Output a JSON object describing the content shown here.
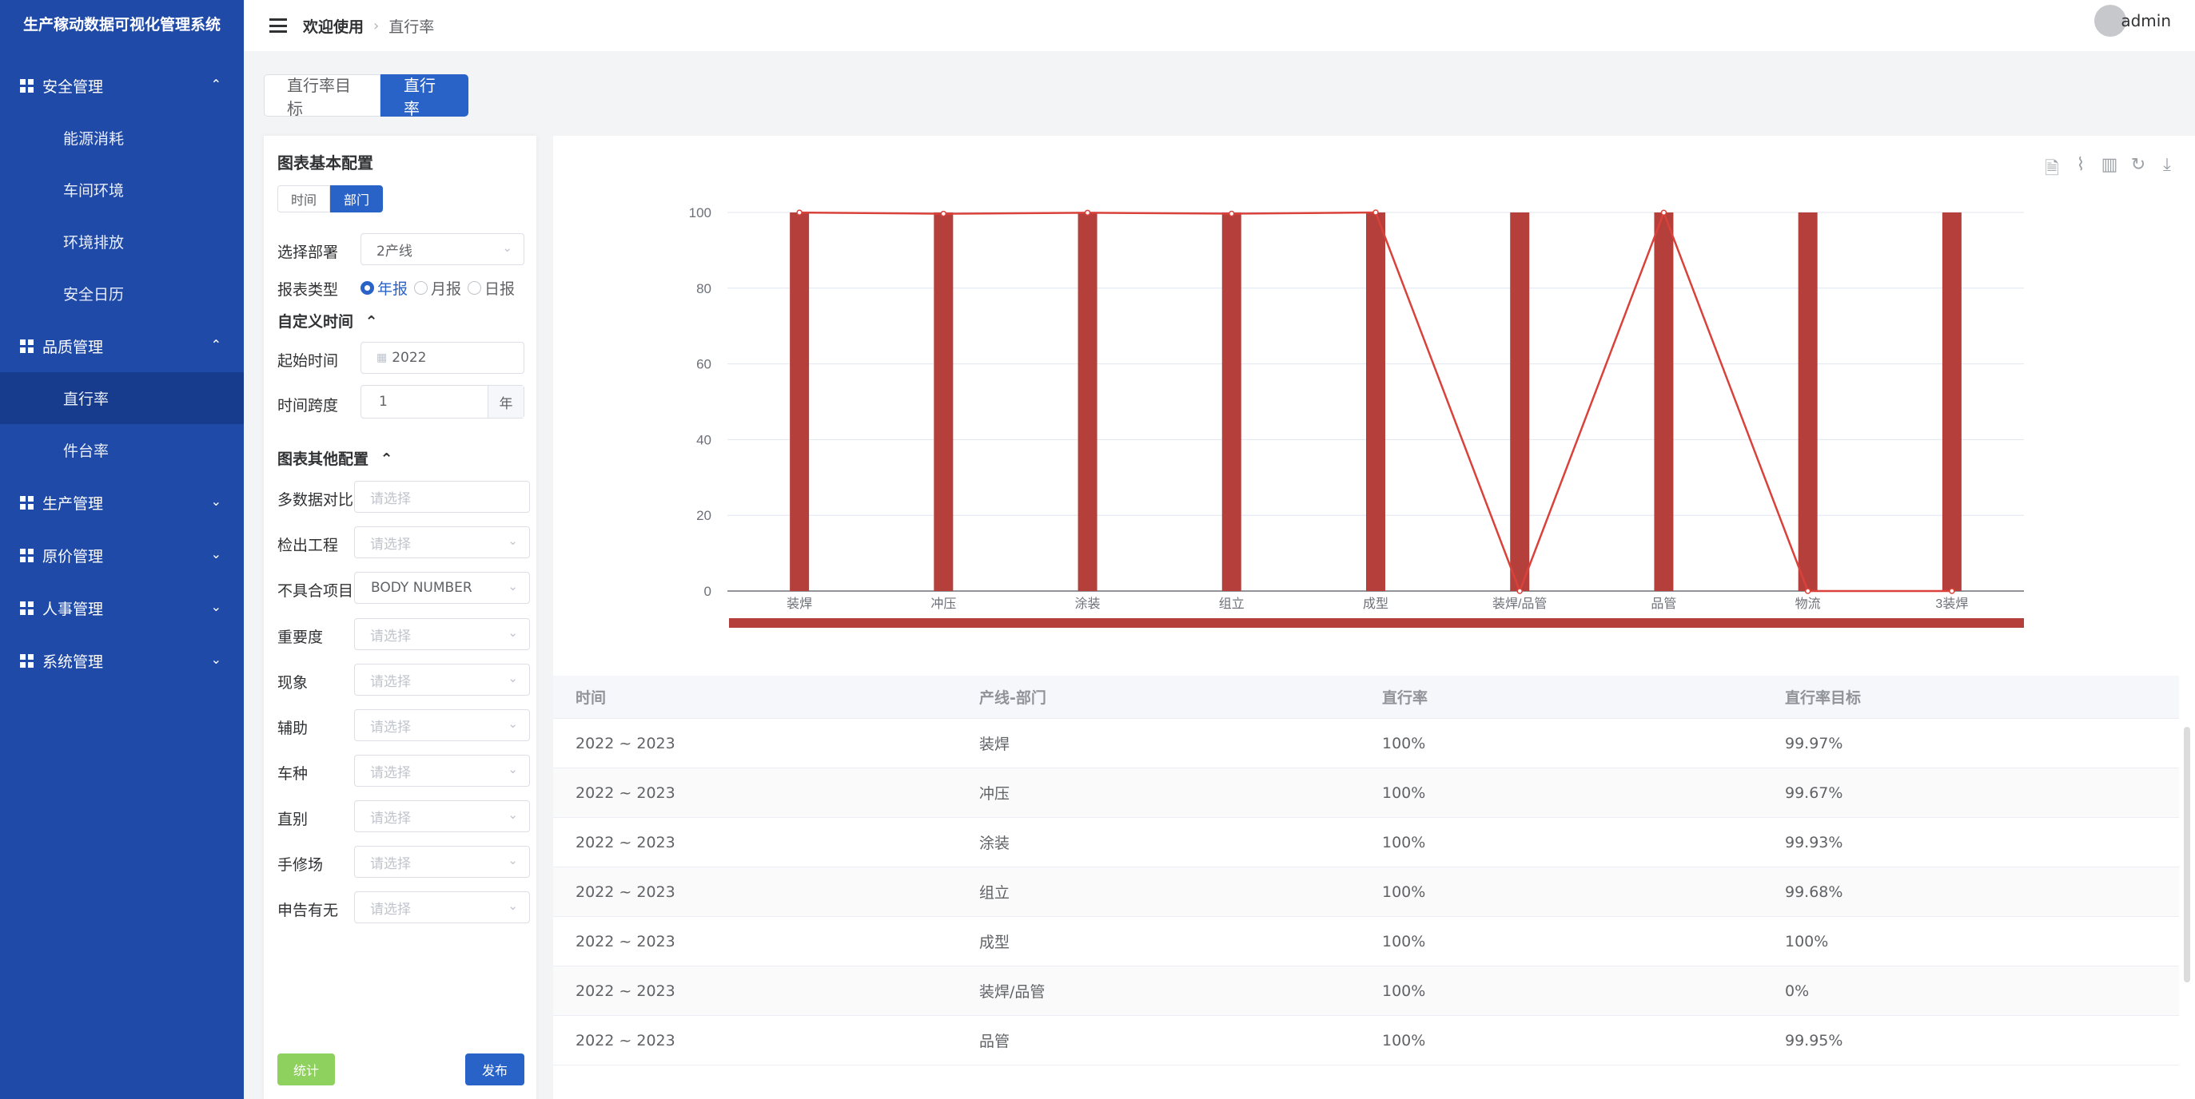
{
  "app": {
    "title": "生产稼动数据可视化管理系统"
  },
  "sidebar": {
    "groups": [
      {
        "label": "安全管理",
        "expanded": true,
        "items": [
          "能源消耗",
          "车间环境",
          "环境排放",
          "安全日历"
        ]
      },
      {
        "label": "品质管理",
        "expanded": true,
        "items": [
          "直行率",
          "件台率"
        ]
      },
      {
        "label": "生产管理",
        "expanded": false
      },
      {
        "label": "原价管理",
        "expanded": false
      },
      {
        "label": "人事管理",
        "expanded": false
      },
      {
        "label": "系统管理",
        "expanded": false
      }
    ],
    "active_item": "直行率"
  },
  "header": {
    "breadcrumb": [
      "欢迎使用",
      "直行率"
    ],
    "user": "admin"
  },
  "tabs": [
    {
      "label": "直行率目标",
      "active": false
    },
    {
      "label": "直行率",
      "active": true
    }
  ],
  "config": {
    "basic_title": "图表基本配置",
    "mode_options": [
      "时间",
      "部门"
    ],
    "mode_selected": "部门",
    "dept_label": "选择部署",
    "dept_value": "2产线",
    "report_type_label": "报表类型",
    "report_types": [
      "年报",
      "月报",
      "日报"
    ],
    "report_type_selected": "年报",
    "custom_time_title": "自定义时间",
    "start_label": "起始时间",
    "start_value": "2022",
    "span_label": "时间跨度",
    "span_value": "1",
    "span_unit": "年",
    "other_title": "图表其他配置",
    "placeholder": "请选择",
    "fields": [
      {
        "label": "多数据对比",
        "value": ""
      },
      {
        "label": "检出工程",
        "value": ""
      },
      {
        "label": "不具合项目",
        "value": "BODY NUMBER"
      },
      {
        "label": "重要度",
        "value": ""
      },
      {
        "label": "现象",
        "value": ""
      },
      {
        "label": "辅助",
        "value": ""
      },
      {
        "label": "车种",
        "value": ""
      },
      {
        "label": "直别",
        "value": ""
      },
      {
        "label": "手修场",
        "value": ""
      },
      {
        "label": "申告有无",
        "value": ""
      }
    ],
    "btn_stat": "统计",
    "btn_publish": "发布"
  },
  "chart_data": {
    "type": "bar",
    "categories": [
      "装焊",
      "冲压",
      "涂装",
      "组立",
      "成型",
      "装焊/品管",
      "品管",
      "物流",
      "3装焊"
    ],
    "series": [
      {
        "type": "bar",
        "values": [
          100,
          100,
          100,
          100,
          100,
          100,
          100,
          100,
          100
        ]
      },
      {
        "type": "line",
        "values": [
          99.97,
          99.67,
          99.93,
          99.68,
          100,
          0,
          99.95,
          0,
          0
        ]
      }
    ],
    "ylim": [
      0,
      100
    ],
    "yticks": [
      0,
      20,
      40,
      60,
      80,
      100
    ],
    "grid": true,
    "colors": {
      "bar": "#b5403b",
      "line": "#d9413a"
    }
  },
  "table": {
    "columns": [
      "时间",
      "产线-部门",
      "直行率",
      "直行率目标"
    ],
    "rows": [
      [
        "2022 ~ 2023",
        "装焊",
        "100%",
        "99.97%"
      ],
      [
        "2022 ~ 2023",
        "冲压",
        "100%",
        "99.67%"
      ],
      [
        "2022 ~ 2023",
        "涂装",
        "100%",
        "99.93%"
      ],
      [
        "2022 ~ 2023",
        "组立",
        "100%",
        "99.68%"
      ],
      [
        "2022 ~ 2023",
        "成型",
        "100%",
        "100%"
      ],
      [
        "2022 ~ 2023",
        "装焊/品管",
        "100%",
        "0%"
      ],
      [
        "2022 ~ 2023",
        "品管",
        "100%",
        "99.95%"
      ]
    ]
  }
}
